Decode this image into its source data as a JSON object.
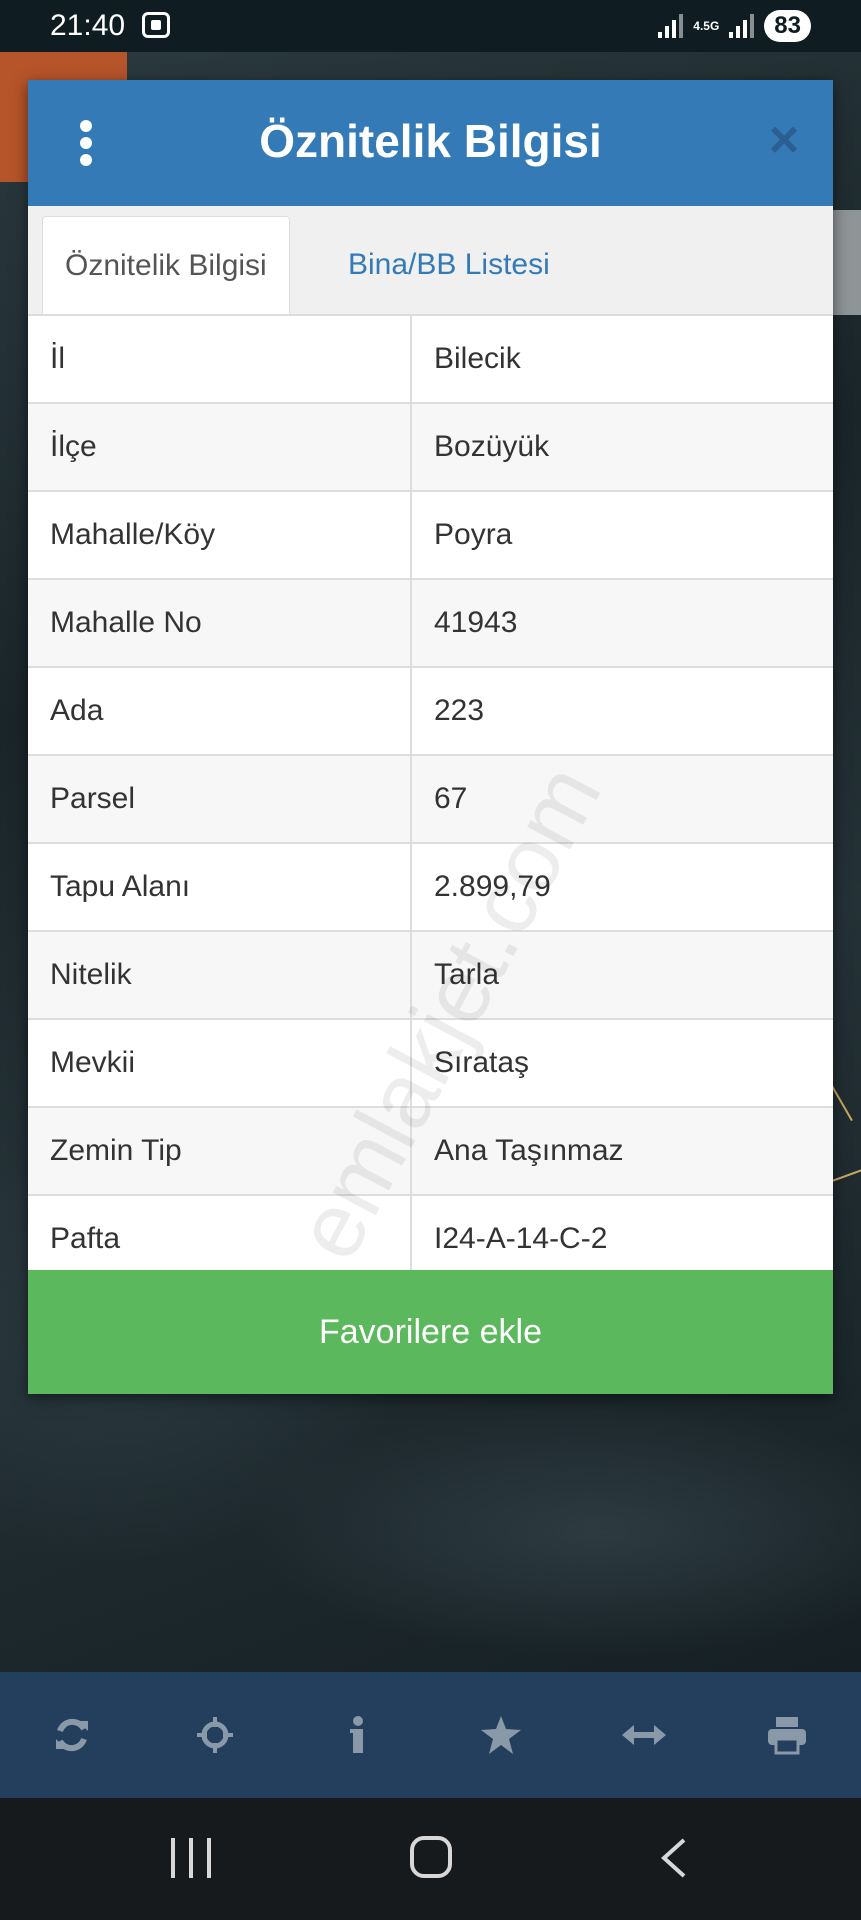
{
  "status_bar": {
    "time": "21:40",
    "network": "4.5G",
    "battery": "83"
  },
  "dialog": {
    "title": "Öznitelik Bilgisi",
    "tabs": [
      {
        "label": "Öznitelik Bilgisi",
        "active": true
      },
      {
        "label": "Bina/BB Listesi",
        "active": false
      }
    ],
    "rows": [
      {
        "key": "İl",
        "value": "Bilecik"
      },
      {
        "key": "İlçe",
        "value": "Bozüyük"
      },
      {
        "key": "Mahalle/Köy",
        "value": "Poyra"
      },
      {
        "key": "Mahalle No",
        "value": "41943"
      },
      {
        "key": "Ada",
        "value": "223"
      },
      {
        "key": "Parsel",
        "value": "67"
      },
      {
        "key": "Tapu Alanı",
        "value": "2.899,79"
      },
      {
        "key": "Nitelik",
        "value": "Tarla"
      },
      {
        "key": "Mevkii",
        "value": "Sırataş"
      },
      {
        "key": "Zemin Tip",
        "value": "Ana Taşınmaz"
      },
      {
        "key": "Pafta",
        "value": "I24-A-14-C-2"
      }
    ],
    "favorite_button": "Favorilere ekle"
  },
  "watermark": "emlakjet.com",
  "toolbar": {
    "icons": [
      "refresh-icon",
      "locate-icon",
      "info-icon",
      "star-icon",
      "measure-icon",
      "print-icon"
    ]
  },
  "colors": {
    "header": "#337ab7",
    "favorite": "#5cb85c",
    "toolbar": "#243f5e"
  }
}
